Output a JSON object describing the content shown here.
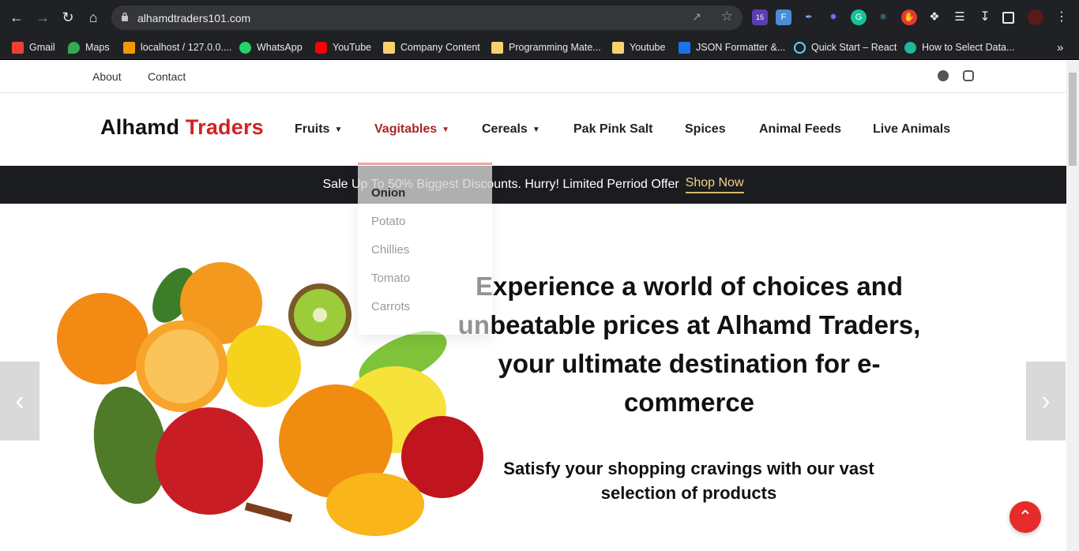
{
  "browser": {
    "url": "alhamdtraders101.com",
    "extension_badge": "15",
    "bookmarks": [
      {
        "label": "Gmail",
        "color": "#ea4335"
      },
      {
        "label": "Maps",
        "color": "#34a853"
      },
      {
        "label": "localhost / 127.0.0....",
        "color": "#f29900"
      },
      {
        "label": "WhatsApp",
        "color": "#25d366"
      },
      {
        "label": "YouTube",
        "color": "#ff0000"
      },
      {
        "label": "Company Content",
        "color": "#f9d26e"
      },
      {
        "label": "Programming Mate...",
        "color": "#f9d26e"
      },
      {
        "label": "Youtube",
        "color": "#f9d26e"
      },
      {
        "label": "JSON Formatter &...",
        "color": "#1a73e8"
      },
      {
        "label": "Quick Start – React",
        "color": "#61dafb"
      },
      {
        "label": "How to Select Data...",
        "color": "#1fb89a"
      }
    ],
    "overflow": "»"
  },
  "site": {
    "top_links": [
      "About",
      "Contact"
    ],
    "logo_main": "Alhamd",
    "logo_accent": "Traders",
    "menu": [
      {
        "label": "Fruits",
        "has_caret": true
      },
      {
        "label": "Vagitables",
        "has_caret": true
      },
      {
        "label": "Cereals",
        "has_caret": true
      },
      {
        "label": "Pak Pink Salt",
        "has_caret": false
      },
      {
        "label": "Spices",
        "has_caret": false
      },
      {
        "label": "Animal Feeds",
        "has_caret": false
      },
      {
        "label": "Live Animals",
        "has_caret": false
      }
    ],
    "dropdown": [
      "Onion",
      "Potato",
      "Chillies",
      "Tomato",
      "Carrots"
    ],
    "promo_text": "Sale Up To 50% Biggest Discounts. Hurry! Limited Perriod Offer",
    "promo_link": "Shop Now",
    "hero_headline": "Experience a world of choices and unbeatable prices at Alhamd Traders, your ultimate destination for e-commerce",
    "hero_sub": "Satisfy your shopping cravings with our vast selection of products"
  },
  "colors": {
    "brand_red": "#d32222",
    "menu_active": "#a8262b",
    "promo_bg": "#1b1c20",
    "fab": "#e62b2b"
  }
}
